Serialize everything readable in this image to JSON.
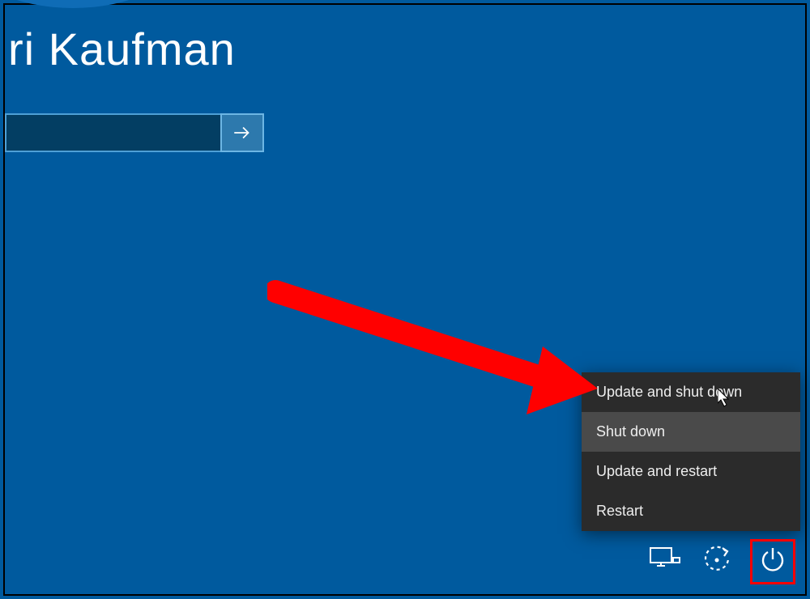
{
  "user": {
    "display_name": "ri Kaufman"
  },
  "password": {
    "value": "",
    "placeholder": ""
  },
  "power_menu": {
    "items": [
      {
        "label": "Update and shut down",
        "hovered": false
      },
      {
        "label": "Shut down",
        "hovered": true
      },
      {
        "label": "Update and restart",
        "hovered": false
      },
      {
        "label": "Restart",
        "hovered": false
      }
    ]
  },
  "tray": {
    "network_icon": "network-display-icon",
    "ease_icon": "ease-of-access-icon",
    "power_icon": "power-icon"
  },
  "colors": {
    "background": "#005a9e",
    "menu_bg": "#2b2b2b",
    "menu_hover": "#4a4a4a",
    "highlight": "#ff0000"
  }
}
